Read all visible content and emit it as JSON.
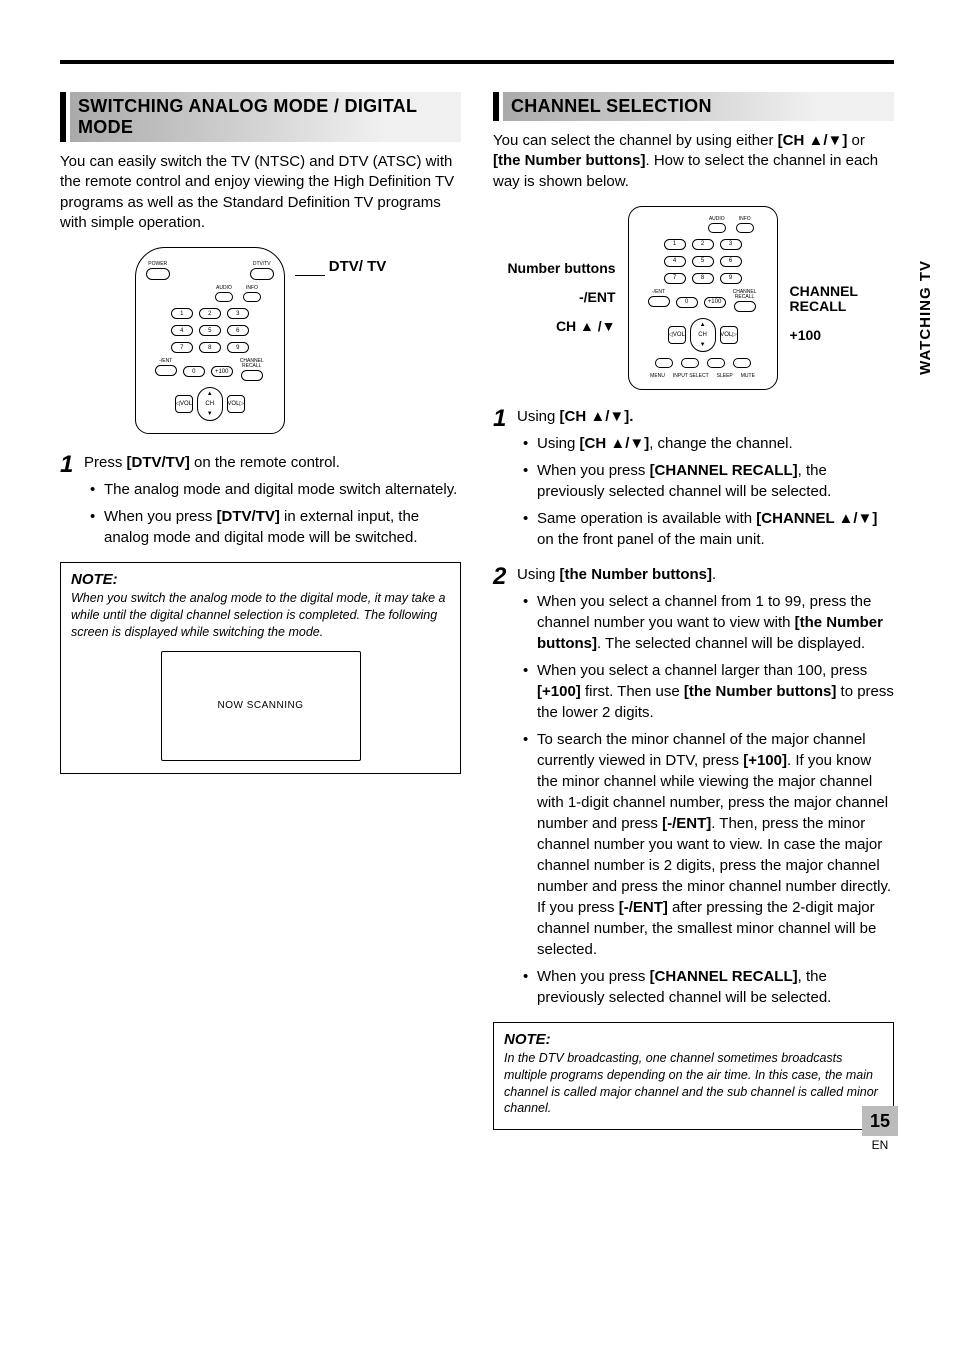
{
  "sideTab": "WATCHING TV",
  "pageNumber": "15",
  "pageLang": "EN",
  "left": {
    "sectionTitle": "SWITCHING ANALOG MODE / DIGITAL MODE",
    "intro": "You can easily switch the TV (NTSC) and DTV (ATSC) with the remote control and enjoy viewing the High Definition TV programs as well as the Standard Definition TV programs with simple operation.",
    "callout": "DTV/ TV",
    "remoteLabels": {
      "power": "POWER",
      "dtvtv": "DTV/TV",
      "audio": "AUDIO",
      "info": "INFO",
      "n1": "1",
      "n2": "2",
      "n3": "3",
      "n4": "4",
      "n5": "5",
      "n6": "6",
      "n7": "7",
      "n8": "8",
      "n9": "9",
      "n0": "0",
      "ent": "-/ENT",
      "p100": "+100",
      "chrec": "CHANNEL RECALL",
      "vol": "VOL",
      "ch": "CH"
    },
    "step1_lead": "Press ",
    "step1_bold": "[DTV/TV]",
    "step1_trail": " on the remote control.",
    "bullet1": "The analog mode and digital mode switch alternately.",
    "bullet2_a": "When you press ",
    "bullet2_b": "[DTV/TV]",
    "bullet2_c": " in external input, the analog mode and digital mode will be switched.",
    "noteTitle": "NOTE:",
    "noteText": "When you switch the analog mode to the digital mode, it may take a while until the digital channel selection is completed. The following screen is displayed while switching the mode.",
    "scanText": "NOW SCANNING"
  },
  "right": {
    "sectionTitle": "CHANNEL SELECTION",
    "intro_a": "You can select the channel by using either ",
    "intro_b": "[CH ▲/▼]",
    "intro_c": " or ",
    "intro_d": "[the Number buttons]",
    "intro_e": ". How to select the channel in each way is shown below.",
    "labelsL": {
      "numButtons": "Number buttons",
      "ent": "-/ENT",
      "chUpDn": "CH ▲ /▼"
    },
    "labelsR": {
      "channelRecall": "CHANNEL RECALL",
      "p100": "+100"
    },
    "remoteLabels": {
      "audio": "AUDIO",
      "info": "INFO",
      "n1": "1",
      "n2": "2",
      "n3": "3",
      "n4": "4",
      "n5": "5",
      "n6": "6",
      "n7": "7",
      "n8": "8",
      "n9": "9",
      "n0": "0",
      "ent": "-/ENT",
      "p100": "+100",
      "chrec": "CHANNEL RECALL",
      "vol": "VOL",
      "ch": "CH",
      "menu": "MENU",
      "input": "INPUT SELECT",
      "sleep": "SLEEP",
      "mute": "MUTE"
    },
    "step1_a": "Using ",
    "step1_b": "[CH ▲/▼].",
    "s1b1_a": "Using ",
    "s1b1_b": "[CH ▲/▼]",
    "s1b1_c": ", change the channel.",
    "s1b2_a": "When you press ",
    "s1b2_b": "[CHANNEL RECALL]",
    "s1b2_c": ", the previously selected channel will be selected.",
    "s1b3_a": "Same operation is available with ",
    "s1b3_b": "[CHANNEL ▲/▼]",
    "s1b3_c": " on the front panel of the main unit.",
    "step2_a": "Using ",
    "step2_b": "[the Number buttons]",
    "step2_c": ".",
    "s2b1_a": "When you select a channel from 1 to 99, press the channel number you want to view with ",
    "s2b1_b": "[the Number buttons]",
    "s2b1_c": ". The selected channel will be displayed.",
    "s2b2_a": "When you select a channel larger than 100, press ",
    "s2b2_b": "[+100]",
    "s2b2_c": " first. Then use ",
    "s2b2_d": "[the Number buttons]",
    "s2b2_e": " to press the lower 2 digits.",
    "s2b3_a": "To search the minor channel of the major channel currently viewed in DTV, press ",
    "s2b3_b": "[+100]",
    "s2b3_c": ". If you know the minor channel while viewing the major channel with 1-digit channel number, press the major channel number and press ",
    "s2b3_d": "[-/ENT]",
    "s2b3_e": ". Then, press the minor channel number you want to view. In case the major channel number is 2 digits, press the major channel number and press the minor channel number directly. If you press ",
    "s2b3_f": "[-/ENT]",
    "s2b3_g": " after pressing the 2-digit major channel number, the smallest minor channel will be selected.",
    "s2b4_a": "When you press ",
    "s2b4_b": "[CHANNEL RECALL]",
    "s2b4_c": ", the previously selected channel will be selected.",
    "noteTitle": "NOTE:",
    "noteText": "In the DTV broadcasting, one channel sometimes broadcasts multiple programs depending on the air time. In this case, the main channel is called major channel and the sub channel is called minor channel."
  }
}
